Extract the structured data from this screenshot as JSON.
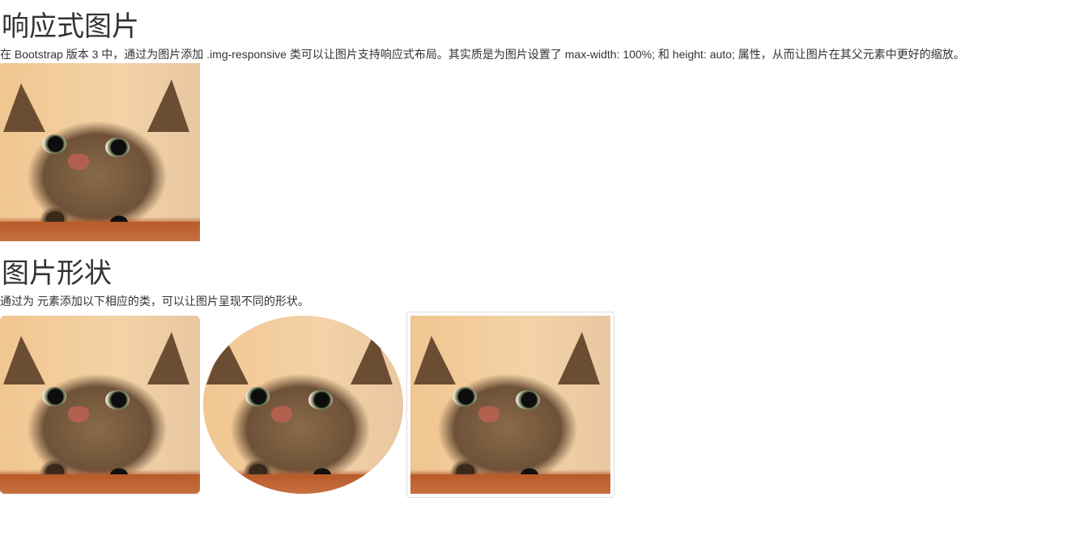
{
  "section1": {
    "title": "响应式图片",
    "description": "在 Bootstrap 版本 3 中，通过为图片添加 .img-responsive 类可以让图片支持响应式布局。其实质是为图片设置了 max-width: 100%; 和 height: auto; 属性，从而让图片在其父元素中更好的缩放。"
  },
  "section2": {
    "title": "图片形状",
    "description": "通过为  元素添加以下相应的类，可以让图片呈现不同的形状。"
  }
}
